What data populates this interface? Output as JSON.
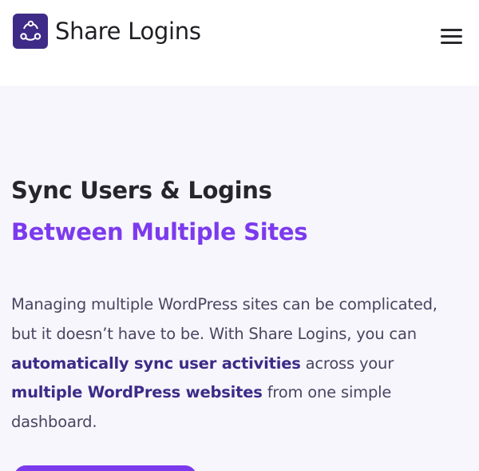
{
  "brand": {
    "name": "Share Logins",
    "logo_icon": "share-nodes-icon",
    "logo_color": "#3d2b87"
  },
  "nav": {
    "menu_icon": "hamburger-menu-icon"
  },
  "hero": {
    "title_line1": "Sync Users & Logins",
    "title_line2": "Between Multiple Sites",
    "desc_part1": "Managing multiple WordPress sites can be complicated, but it doesn’t have to be. With Share Logins, you can ",
    "desc_bold1": "automatically sync user activities",
    "desc_part2": " across your ",
    "desc_bold2": "multiple WordPress websites",
    "desc_part3": " from one simple dashboard."
  },
  "colors": {
    "accent": "#7c3aed",
    "heading": "#25252b",
    "body_text": "#4a4560",
    "hero_background": "#f7f6fd"
  }
}
